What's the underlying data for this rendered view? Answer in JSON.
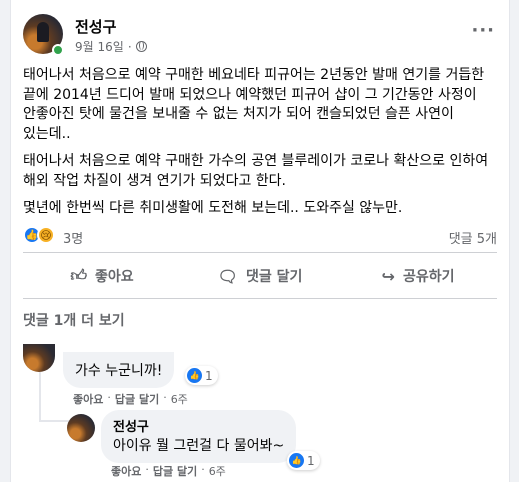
{
  "post": {
    "author": "전성구",
    "date": "9월 16일",
    "separator": "·",
    "more_icon": "···",
    "paragraphs": [
      "태어나서 처음으로 예약 구매한 베요네타 피규어는 2년동안 발매 연기를 거듭한 끝에 2014년 드디어 발매 되었으나 예약했던 피규어 샵이 그 기간동안 사정이 안좋아진 탓에 물건을 보내줄 수 없는 처지가 되어 캔슬되었던 슬픈 사연이 있는데..",
      "태어나서 처음으로 예약 구매한 가수의 공연 블루레이가 코로나 확산으로 인하여 해외 작업 차질이 생겨 연기가 되었다고 한다.",
      "몇년에 한번씩 다른 취미생활에 도전해 보는데.. 도와주실 않누만."
    ],
    "reaction_count": "3명",
    "comment_count": "댓글 5개"
  },
  "actions": {
    "like": "좋아요",
    "comment": "댓글 달기",
    "share": "공유하기"
  },
  "more_comments": "댓글 1개 더 보기",
  "comments": [
    {
      "text": "가수 누군니까!",
      "reactions": "1",
      "like": "좋아요",
      "reply": "답글 달기",
      "time": "6주"
    },
    {
      "author": "전성구",
      "text": "아이유 뭘 그런걸 다 물어봐~",
      "reactions": "1",
      "like": "좋아요",
      "reply": "답글 달기",
      "time": "6주"
    }
  ],
  "colors": {
    "like_blue": "#1877f2",
    "online_green": "#31a24c",
    "secondary_text": "#65676b"
  }
}
